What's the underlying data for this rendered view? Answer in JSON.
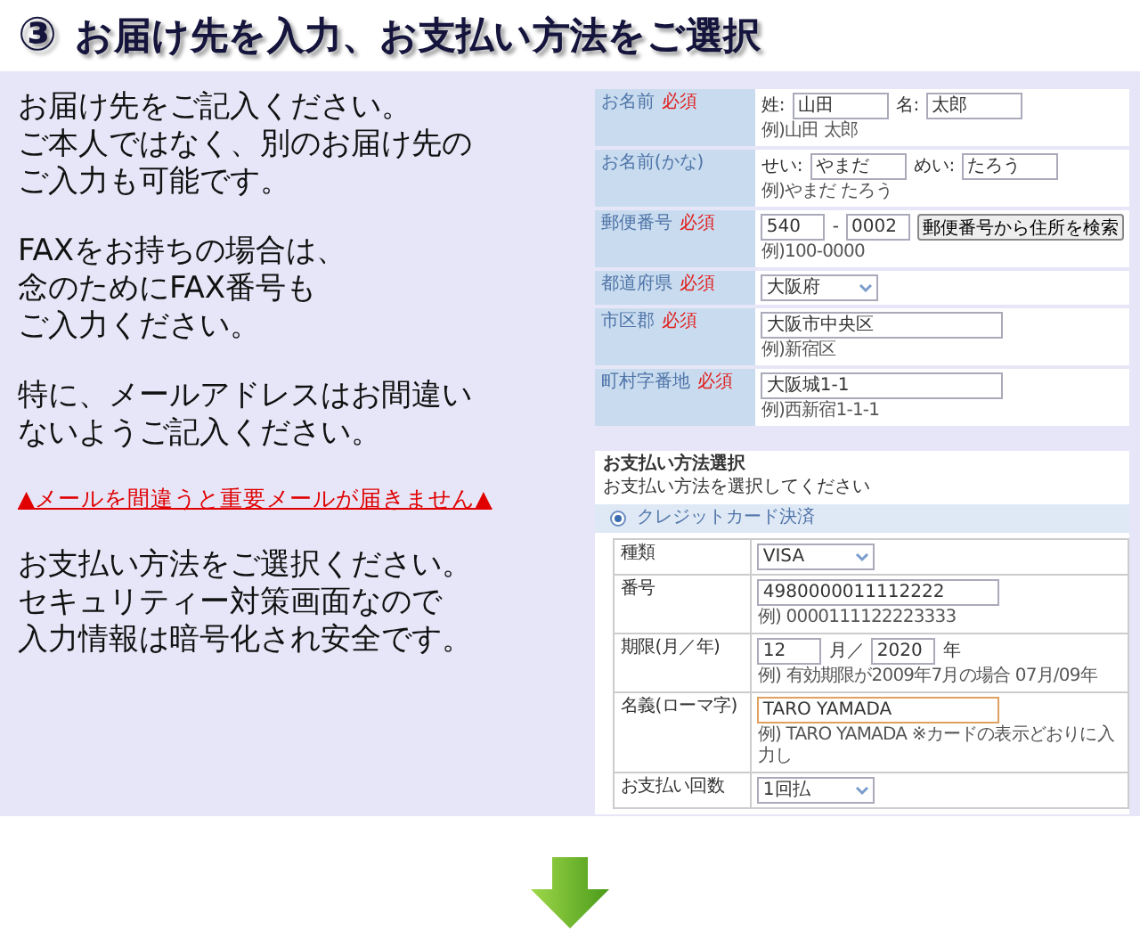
{
  "header": {
    "number": "③",
    "title": "お届け先を入力、お支払い方法をご選択"
  },
  "instructions": [
    {
      "kind": "text",
      "lines": [
        "お届け先をご記入ください。",
        "ご本人ではなく、別のお届け先の",
        "ご入力も可能です。"
      ]
    },
    {
      "kind": "text",
      "lines": [
        "FAXをお持ちの場合は、",
        "念のためにFAX番号も",
        "ご入力ください。"
      ]
    },
    {
      "kind": "text",
      "lines": [
        "特に、メールアドレスはお間違い",
        "ないようご記入ください。"
      ]
    },
    {
      "kind": "warning",
      "lines": [
        "▲メールを間違うと重要メールが届きません▲"
      ]
    },
    {
      "kind": "text",
      "lines": [
        "お支払い方法をご選択ください。",
        "セキュリティー対策画面なので",
        "入力情報は暗号化され安全です。"
      ]
    }
  ],
  "address_form": {
    "rows": [
      {
        "label": "お名前",
        "required": true,
        "required_label": "必須",
        "items": [
          {
            "kind": "text",
            "text": "姓:"
          },
          {
            "kind": "input",
            "value": "山田"
          },
          {
            "kind": "text",
            "text": "名:"
          },
          {
            "kind": "input",
            "value": "太郎"
          }
        ],
        "hint": "例)山田 太郎"
      },
      {
        "label": "お名前(かな)",
        "required": false,
        "items": [
          {
            "kind": "text",
            "text": "せい:"
          },
          {
            "kind": "input",
            "value": "やまだ"
          },
          {
            "kind": "text",
            "text": "めい:"
          },
          {
            "kind": "input",
            "value": "たろう"
          }
        ],
        "hint": "例)やまだ たろう"
      },
      {
        "label": "郵便番号",
        "required": true,
        "required_label": "必須",
        "items": [
          {
            "kind": "short",
            "value": "540"
          },
          {
            "kind": "text",
            "text": "-"
          },
          {
            "kind": "short",
            "value": "0002"
          },
          {
            "kind": "button",
            "text": "郵便番号から住所を検索"
          }
        ],
        "hint": "例)100-0000"
      },
      {
        "label": "都道府県",
        "required": true,
        "required_label": "必須",
        "items": [
          {
            "kind": "select",
            "value": "大阪府"
          }
        ]
      },
      {
        "label": "市区郡",
        "required": true,
        "required_label": "必須",
        "items": [
          {
            "kind": "wide",
            "value": "大阪市中央区"
          }
        ],
        "hint": "例)新宿区"
      },
      {
        "label": "町村字番地",
        "required": true,
        "required_label": "必須",
        "items": [
          {
            "kind": "wide",
            "value": "大阪城1-1"
          }
        ],
        "hint": "例)西新宿1-1-1"
      }
    ]
  },
  "payment_form": {
    "title": "お支払い方法選択",
    "subtitle": "お支払い方法を選択してください",
    "option": {
      "label": "クレジットカード決済",
      "selected": true
    },
    "rows": [
      {
        "label": "種類",
        "items": [
          {
            "kind": "select",
            "value": "VISA"
          }
        ]
      },
      {
        "label": "番号",
        "items": [
          {
            "kind": "wide",
            "value": "4980000011112222"
          }
        ],
        "hint": "例) 0000111122223333"
      },
      {
        "label": "期限(月／年)",
        "items": [
          {
            "kind": "short",
            "value": "12"
          },
          {
            "kind": "text",
            "text": "月／"
          },
          {
            "kind": "short",
            "value": "2020"
          },
          {
            "kind": "text",
            "text": "年"
          }
        ],
        "hint": "例) 有効期限が2009年7月の場合 07月/09年"
      },
      {
        "label": "名義(ローマ字)",
        "items": [
          {
            "kind": "focused",
            "value": "TARO YAMADA"
          }
        ],
        "hint": "例) TARO YAMADA ※カードの表示どおりに入力し"
      },
      {
        "label": "お支払い回数",
        "items": [
          {
            "kind": "select",
            "value": "1回払"
          }
        ]
      }
    ]
  }
}
